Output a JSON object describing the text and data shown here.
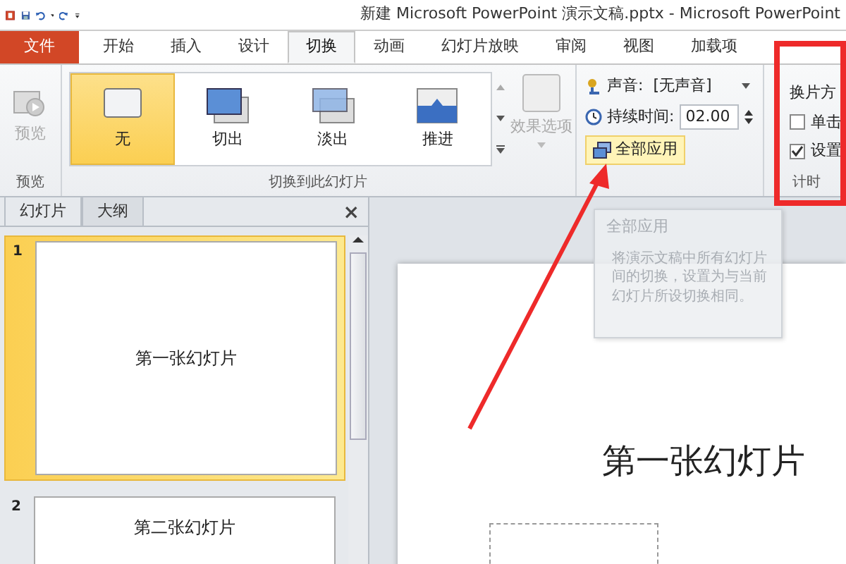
{
  "window": {
    "title": "新建 Microsoft PowerPoint 演示文稿.pptx  -  Microsoft PowerPoint"
  },
  "ribbon_tabs": [
    {
      "label": "文件",
      "kind": "file",
      "selected": false
    },
    {
      "label": "开始",
      "kind": "tab",
      "selected": false
    },
    {
      "label": "插入",
      "kind": "tab",
      "selected": false
    },
    {
      "label": "设计",
      "kind": "tab",
      "selected": false
    },
    {
      "label": "切换",
      "kind": "tab",
      "selected": true
    },
    {
      "label": "动画",
      "kind": "tab",
      "selected": false
    },
    {
      "label": "幻灯片放映",
      "kind": "tab",
      "selected": false
    },
    {
      "label": "审阅",
      "kind": "tab",
      "selected": false
    },
    {
      "label": "视图",
      "kind": "tab",
      "selected": false
    },
    {
      "label": "加载项",
      "kind": "tab",
      "selected": false
    }
  ],
  "ribbon": {
    "preview": {
      "label": "预览",
      "disabled": true,
      "group": "预览"
    },
    "transitions": {
      "items": [
        {
          "label": "无",
          "selected": true
        },
        {
          "label": "切出",
          "selected": false
        },
        {
          "label": "淡出",
          "selected": false
        },
        {
          "label": "推进",
          "selected": false
        }
      ],
      "effect_options": {
        "label": "效果选项",
        "disabled": true
      },
      "group": "切换到此幻灯片"
    },
    "timing": {
      "sound": {
        "label": "声音:",
        "value": "[无声音]"
      },
      "duration": {
        "label": "持续时间:",
        "value": "02.00"
      },
      "apply_all": {
        "label": "全部应用",
        "hovered": true
      }
    },
    "advance": {
      "title": "换片方",
      "options": [
        {
          "label": "单击",
          "checked": false
        },
        {
          "label": "设置",
          "checked": true
        }
      ],
      "group": "计时"
    }
  },
  "tooltip": {
    "title": "全部应用",
    "text": "将演示文稿中所有幻灯片间的切换，设置为与当前幻灯片所设切换相同。"
  },
  "panel": {
    "tabs": [
      {
        "label": "幻灯片",
        "selected": true
      },
      {
        "label": "大纲",
        "selected": false
      }
    ],
    "close": "×",
    "slides": [
      {
        "number": "1",
        "title": "第一张幻灯片",
        "selected": true
      },
      {
        "number": "2",
        "title": "第二张幻灯片",
        "selected": false
      }
    ]
  },
  "slide": {
    "title": "第一张幻灯片"
  }
}
